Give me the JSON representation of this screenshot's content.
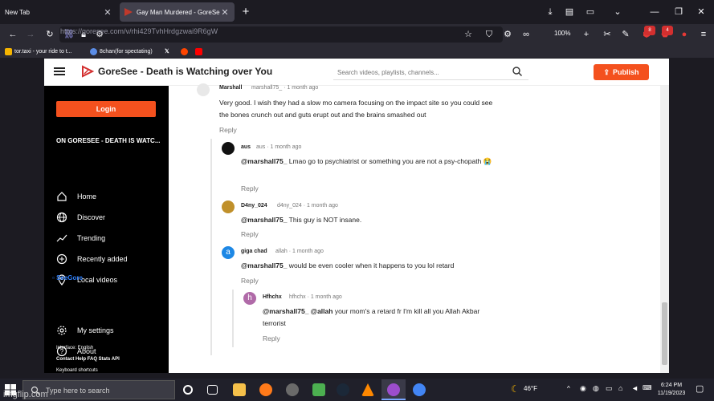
{
  "browser": {
    "tabs": [
      {
        "label": "New Tab"
      },
      {
        "label": "Gay Man Murdered - GoreSee - "
      }
    ],
    "url": "https://goresee.com/v/rhi429TvhHrdgzwai9R6gW",
    "zoom": "100%",
    "badges": [
      "8",
      "4"
    ],
    "bookmarks": [
      {
        "label": "tor.taxi - your ride to t..."
      },
      {
        "label": "8chan(for spectating)"
      }
    ]
  },
  "site": {
    "title": "GoreSee - Death is Watching over You",
    "search_placeholder": "Search videos, playlists, channels...",
    "publish_label": "Publish",
    "brand_color": "#f4511e"
  },
  "sidebar": {
    "login_label": "Login",
    "heading": "ON GORESEE - DEATH IS WATC...",
    "items": [
      {
        "label": "Home",
        "icon": "home-icon"
      },
      {
        "label": "Discover",
        "icon": "globe-icon"
      },
      {
        "label": "Trending",
        "icon": "trending-icon"
      },
      {
        "label": "Recently added",
        "icon": "add-circle-icon"
      },
      {
        "label": "Local videos",
        "icon": "location-icon"
      }
    ],
    "seegore": "SeeGore",
    "settings": [
      {
        "label": "My settings",
        "icon": "gear-icon"
      },
      {
        "label": "About",
        "icon": "help-icon"
      }
    ],
    "footer_interface": "Interface: English",
    "footer_links": "Contact  Help  FAQ  Stats  API",
    "footer_shortcuts": "Keyboard shortcuts"
  },
  "comments": [
    {
      "name": "Marshall",
      "handle": "marshall75_ · 1 month ago",
      "text": "Very good. I wish they had a slow mo camera focusing on the impact site so you could see the bones crunch out and guts erupt out and the brains smashed out",
      "reply": "Reply"
    },
    {
      "name": "aus",
      "handle": "aus · 1 month ago",
      "mention": "@marshall75_",
      "text": " Lmao go to psychiatrist or something you are not a psy-chopath 😭",
      "reply": "Reply"
    },
    {
      "name": "D4ny_024",
      "handle": "d4ny_024 · 1 month ago",
      "mention": "@marshall75_",
      "text": " This guy is NOT insane.",
      "reply": "Reply"
    },
    {
      "name": "giga chad",
      "handle": "allah · 1 month ago",
      "avatar_letter": "a",
      "mention": "@marshall75_",
      "text": " would be even cooler when it happens to you lol retard",
      "reply": "Reply"
    },
    {
      "name": "Hfhchx",
      "handle": "hfhchx · 1 month ago",
      "avatar_letter": "h",
      "mention": "@marshall75_ @allah",
      "text": " your mom's a retard fr I'm kill all you Allah Akbar terrorist",
      "reply": "Reply"
    }
  ],
  "taskbar": {
    "search_placeholder": "Type here to search",
    "weather": "46°F",
    "time": "6:24 PM",
    "date": "11/19/2023"
  },
  "watermark": "imgflip.com"
}
